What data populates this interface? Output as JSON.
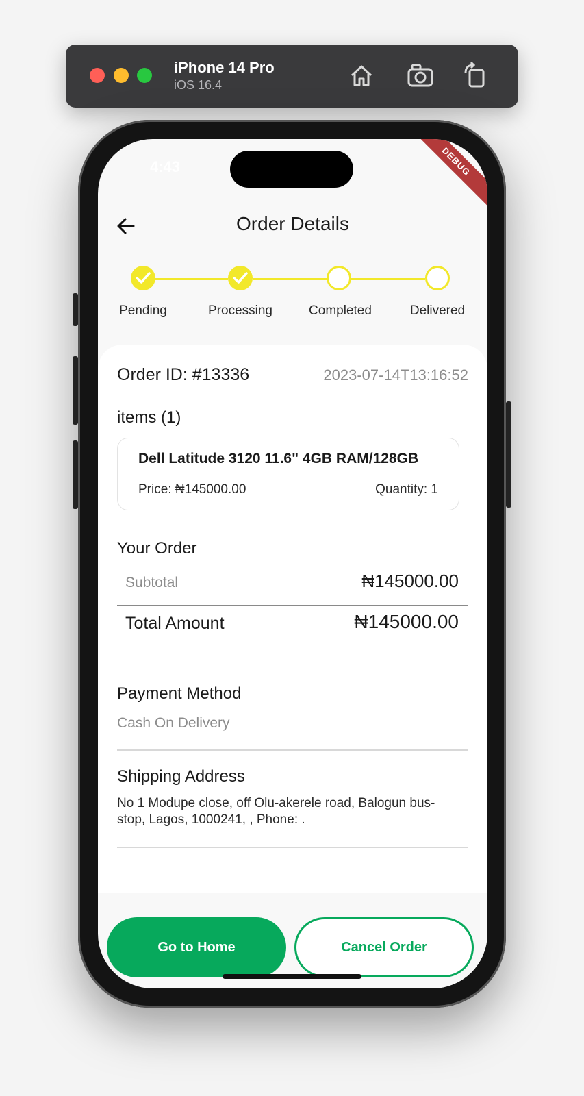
{
  "simulator": {
    "device": "iPhone 14 Pro",
    "os": "iOS 16.4",
    "buttons": [
      "home-icon",
      "screenshot-icon",
      "rotate-icon"
    ]
  },
  "status_bar": {
    "time": "4:43",
    "debug_label": "DEBUG"
  },
  "header": {
    "title": "Order Details",
    "back_icon": "arrow-left-icon"
  },
  "stepper": {
    "color": "#f2e82a",
    "steps": [
      {
        "label": "Pending",
        "done": true
      },
      {
        "label": "Processing",
        "done": true
      },
      {
        "label": "Completed",
        "done": false
      },
      {
        "label": "Delivered",
        "done": false
      }
    ]
  },
  "order": {
    "id_label": "Order ID: #13336",
    "date": "2023-07-14T13:16:52",
    "items_title": "items (1)",
    "items": [
      {
        "name": "Dell Latitude 3120 11.6\" 4GB RAM/128GB",
        "price": "Price: ₦145000.00",
        "quantity": "Quantity: 1"
      }
    ]
  },
  "summary": {
    "title": "Your Order",
    "subtotal_label": "Subtotal",
    "subtotal_value": "₦145000.00",
    "total_label": "Total Amount",
    "total_value": "₦145000.00"
  },
  "payment": {
    "title": "Payment Method",
    "value": "Cash On Delivery"
  },
  "shipping": {
    "title": "Shipping Address",
    "value": "No 1 Modupe close, off Olu-akerele road, Balogun bus-stop, Lagos, 1000241, , Phone: ."
  },
  "actions": {
    "home_label": "Go to Home",
    "cancel_label": "Cancel Order",
    "accent": "#07a95c"
  }
}
